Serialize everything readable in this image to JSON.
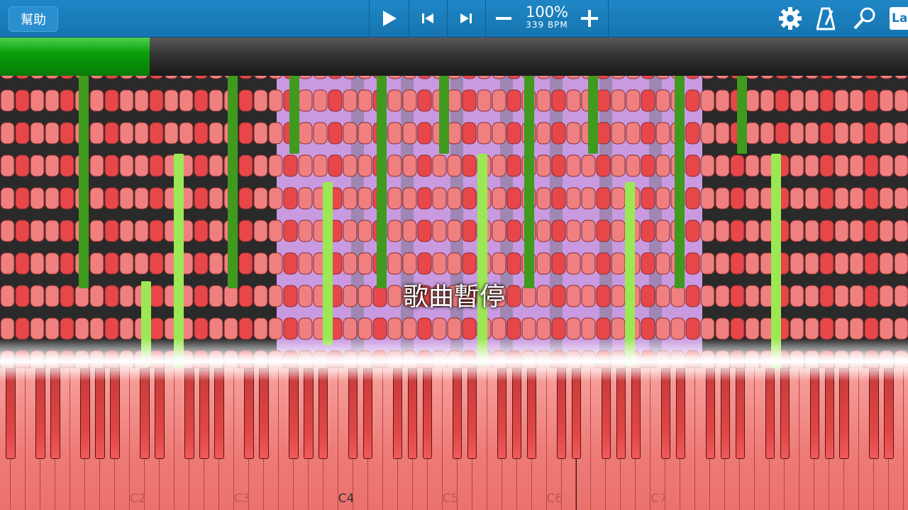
{
  "toolbar": {
    "help_label": "幫助",
    "speed_percent": "100%",
    "bpm_label": "339 BPM",
    "play_icon": "play-icon",
    "prev_icon": "skip-back-icon",
    "next_icon": "skip-forward-icon",
    "minus_icon": "minus-icon",
    "plus_icon": "plus-icon",
    "settings_icon": "gear-icon",
    "metronome_icon": "metronome-icon",
    "search_icon": "search-icon",
    "label_button": "La"
  },
  "progress": {
    "fraction": 0.165
  },
  "status": {
    "paused_label": "歌曲暫停"
  },
  "keyboard": {
    "octave_labels": [
      "C2",
      "C3",
      "C4",
      "C5",
      "C6",
      "C7"
    ]
  },
  "colors": {
    "toolbar": "#1a7dbd",
    "progress": "#0aa00a",
    "note_red": "#e8474a",
    "note_salmon": "#f08080",
    "note_green": "#3f9a1e",
    "note_lightgreen": "#9be854",
    "highlight_purple": "#c99ae0"
  }
}
